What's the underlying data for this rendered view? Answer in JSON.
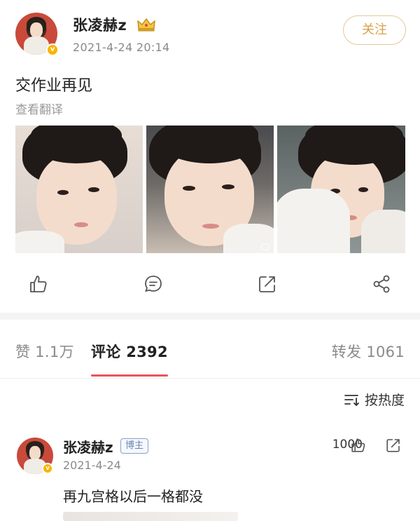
{
  "post": {
    "username": "张凌赫z",
    "time": "2021-4-24 20:14",
    "follow_label": "关注",
    "text": "交作业再见",
    "translate_label": "查看翻译",
    "photo_count": 3,
    "icons": [
      "crown-icon",
      "verified-badge-icon"
    ]
  },
  "actions": {
    "icons": [
      "like-icon",
      "comment-icon",
      "repost-icon",
      "share-icon"
    ]
  },
  "tabs": [
    {
      "label": "赞 1.1万",
      "active": false
    },
    {
      "label": "评论 2392",
      "active": true
    },
    {
      "label": "转发 1061",
      "active": false
    }
  ],
  "sort": {
    "label": "按热度",
    "icon": "sort-icon"
  },
  "comment": {
    "username": "张凌赫z",
    "tag": "博主",
    "date": "2021-4-24",
    "likes": "1000",
    "text": "再九宫格以后一格都没"
  },
  "colors": {
    "accent": "#e8545b",
    "follow": "#d9a24a",
    "verified": "#f7b500",
    "muted_text": "#8a8a8a"
  }
}
